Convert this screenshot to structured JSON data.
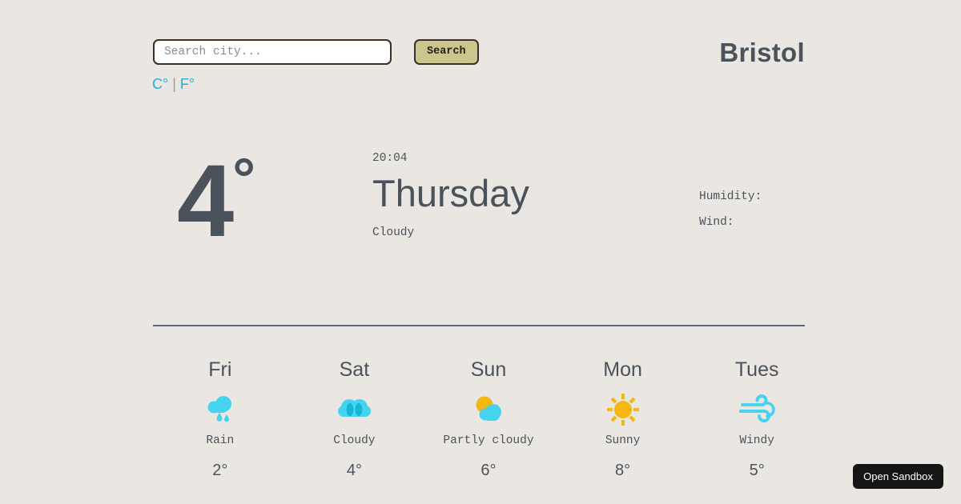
{
  "search": {
    "placeholder": "Search city...",
    "value": "",
    "button_label": "Search"
  },
  "units": {
    "celsius_label": "C°",
    "separator": "|",
    "fahrenheit_label": "F°",
    "link_color": "#29abe2"
  },
  "city": {
    "name": "Bristol"
  },
  "current": {
    "temperature": "4",
    "degree_symbol": "°",
    "time": "20:04",
    "day": "Thursday",
    "condition": "Cloudy",
    "humidity_label": "Humidity:",
    "humidity_value": "",
    "wind_label": "Wind:",
    "wind_value": ""
  },
  "forecast": [
    {
      "day": "Fri",
      "icon": "rain-icon",
      "description": "Rain",
      "temp": "2°"
    },
    {
      "day": "Sat",
      "icon": "cloudy-icon",
      "description": "Cloudy",
      "temp": "4°"
    },
    {
      "day": "Sun",
      "icon": "partly-cloudy-icon",
      "description": "Partly cloudy",
      "temp": "6°"
    },
    {
      "day": "Mon",
      "icon": "sunny-icon",
      "description": "Sunny",
      "temp": "8°"
    },
    {
      "day": "Tues",
      "icon": "windy-icon",
      "description": "Windy",
      "temp": "5°"
    }
  ],
  "sandbox": {
    "label": "Open Sandbox"
  },
  "theme": {
    "background": "#eae7e2",
    "text": "#4a525c",
    "button_fill": "#ccc68e",
    "button_border": "#3b2f26",
    "icon_cyan": "#45d3f0",
    "icon_teal": "#17b6d6",
    "icon_yellow": "#f5b712",
    "divider": "#5c677d"
  }
}
